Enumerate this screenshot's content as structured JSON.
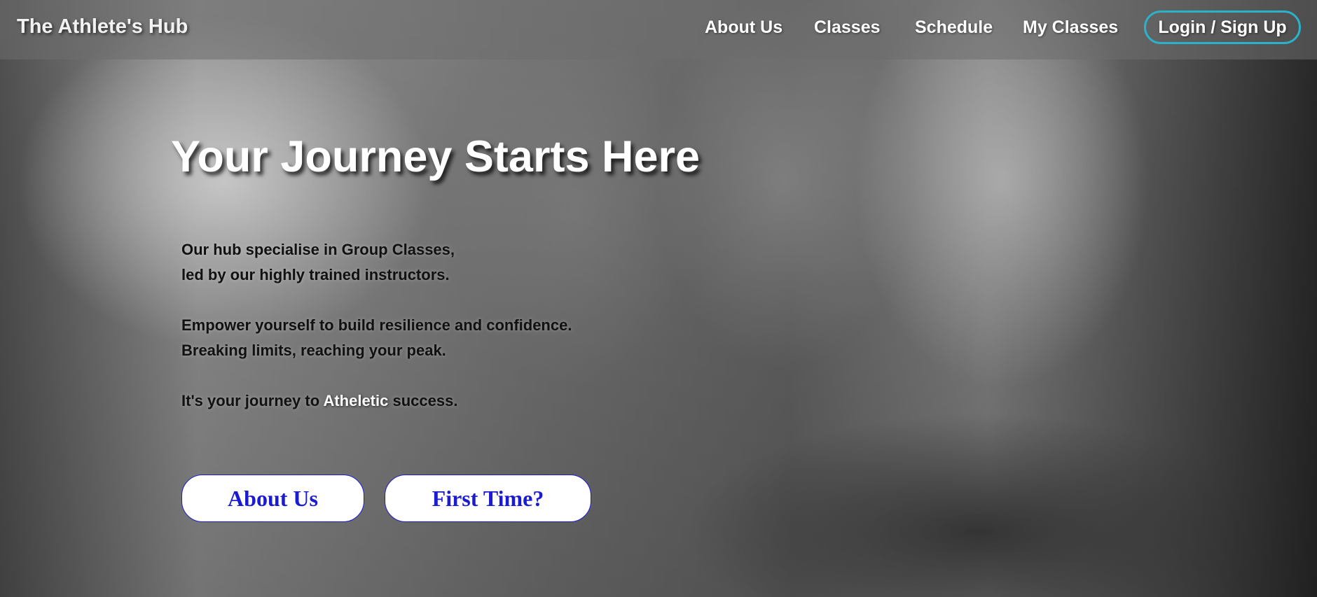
{
  "nav": {
    "brand": "The Athlete's Hub",
    "links": [
      "About Us",
      "Classes",
      "Schedule",
      "My Classes"
    ],
    "login_label": "Login / Sign Up"
  },
  "hero": {
    "title": "Your Journey Starts Here",
    "lines": [
      "Our hub specialise in Group Classes,",
      "led by our highly trained instructors.",
      "Empower yourself to build resilience and confidence.",
      "Breaking limits, reaching your peak."
    ],
    "journey_prefix": "It's your journey to ",
    "journey_highlight": "Atheletic",
    "journey_suffix": " success.",
    "buttons": [
      "About Us",
      "First Time?"
    ]
  },
  "colors": {
    "accent_border": "#2bb1c9",
    "button_text": "#1b1bd0"
  }
}
